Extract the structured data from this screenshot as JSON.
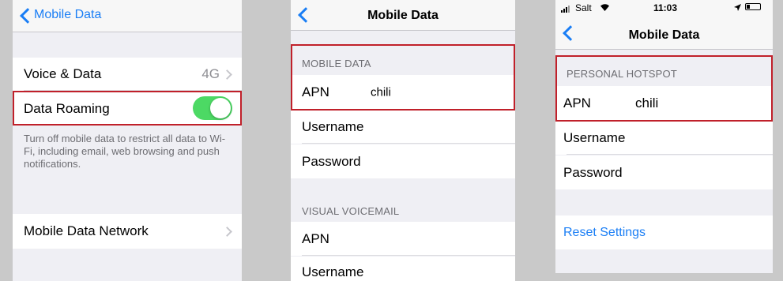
{
  "panel1": {
    "back_label": "Mobile Data",
    "rows": {
      "voice_data": {
        "label": "Voice & Data",
        "value": "4G"
      },
      "data_roaming": {
        "label": "Data Roaming",
        "toggle_on": true
      },
      "mobile_data_network": {
        "label": "Mobile Data Network"
      }
    },
    "footer": "Turn off mobile data to restrict all data to Wi-Fi, including email, web browsing and push notifications."
  },
  "panel2": {
    "title": "Mobile Data",
    "section_mobile_data": "MOBILE DATA",
    "apn_label": "APN",
    "apn_value": "chili",
    "username_label": "Username",
    "password_label": "Password",
    "section_visual_voicemail": "VISUAL VOICEMAIL",
    "vv_apn_label": "APN",
    "vv_username_label": "Username"
  },
  "panel3": {
    "status": {
      "carrier": "Salt",
      "time": "11:03"
    },
    "title": "Mobile Data",
    "section_personal_hotspot": "PERSONAL HOTSPOT",
    "apn_label": "APN",
    "apn_value": "chili",
    "username_label": "Username",
    "password_label": "Password",
    "reset_label": "Reset Settings"
  },
  "colors": {
    "accent": "#1a7ef5",
    "highlight": "#c0202a",
    "toggle_on": "#4cd964"
  }
}
